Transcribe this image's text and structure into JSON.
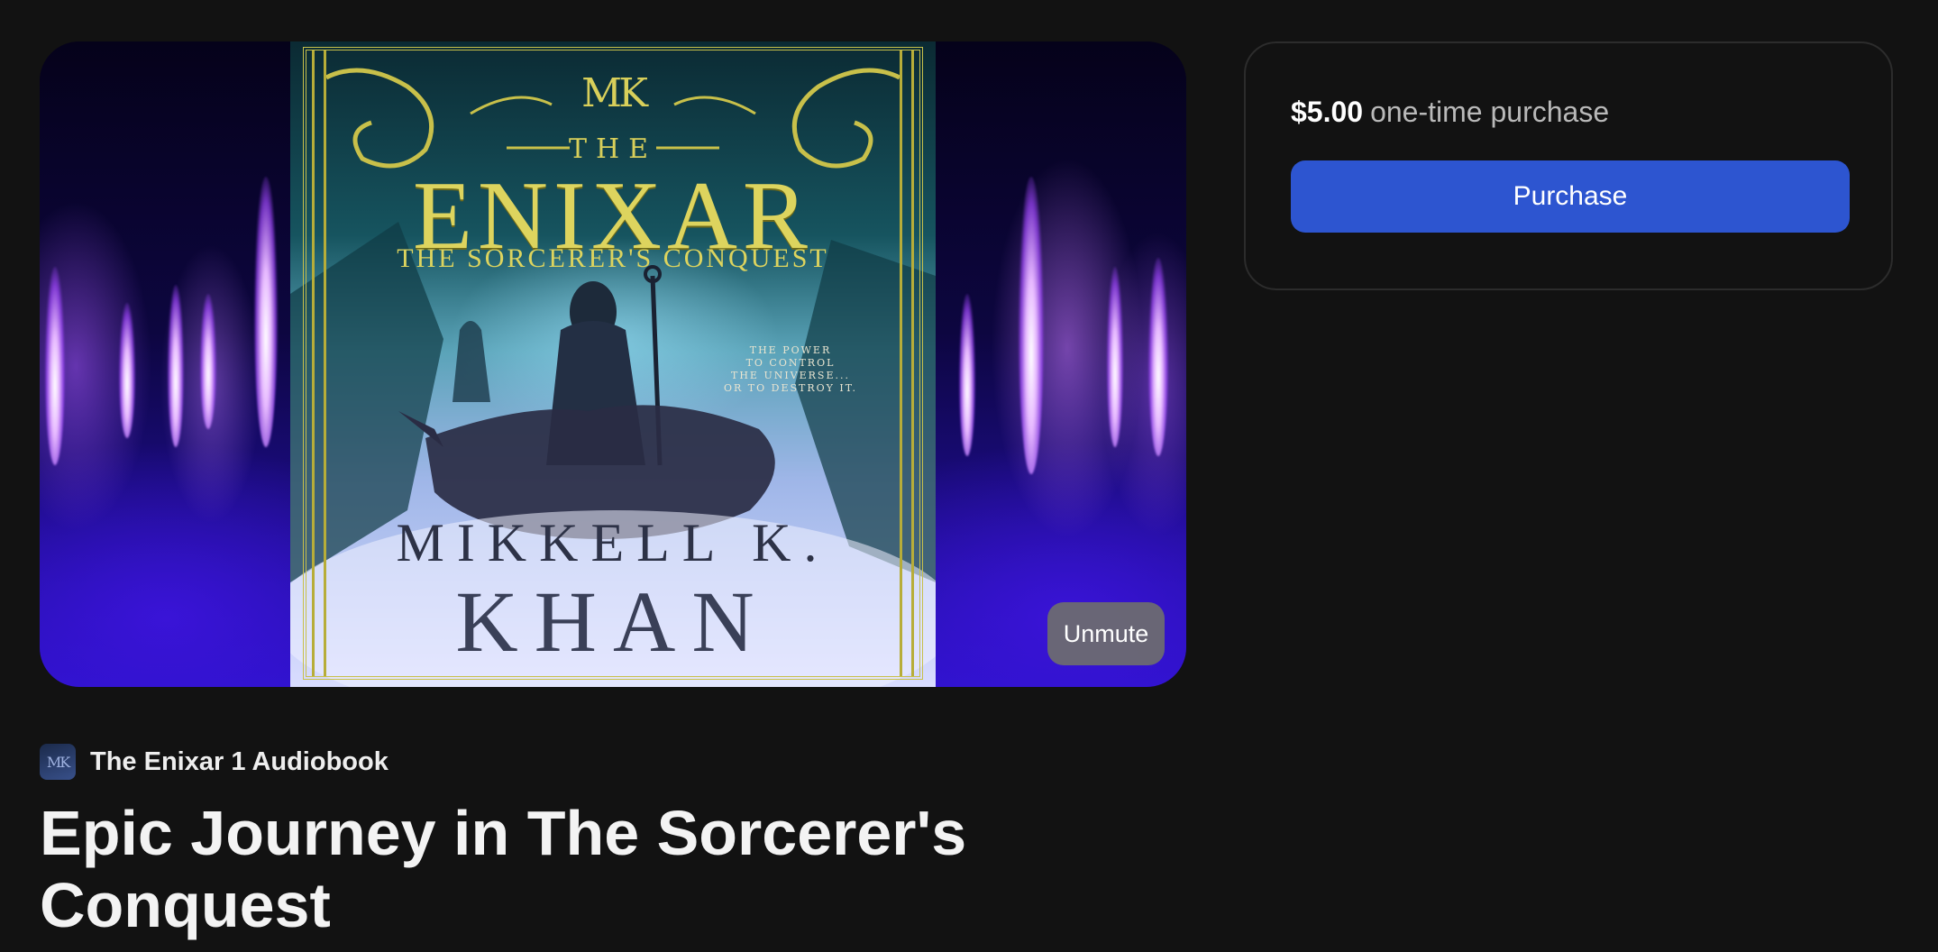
{
  "media": {
    "cover": {
      "monogram": "MK",
      "the": "THE",
      "title": "ENIXAR",
      "subtitle": "THE SORCERER'S CONQUEST",
      "tagline": "THE POWER\nTO CONTROL\nTHE UNIVERSE...\nOR TO DESTROY IT.",
      "author_first": "MIKKELL K.",
      "author_last": "KHAN"
    },
    "unmute_label": "Unmute"
  },
  "purchase": {
    "price": "$5.00",
    "price_note": "one-time purchase",
    "button_label": "Purchase",
    "accent_color": "#2d55d0"
  },
  "show": {
    "thumb_text": "MK",
    "name": "The Enixar 1 Audiobook"
  },
  "episode": {
    "title": "Epic Journey in The Sorcerer's Conquest"
  }
}
